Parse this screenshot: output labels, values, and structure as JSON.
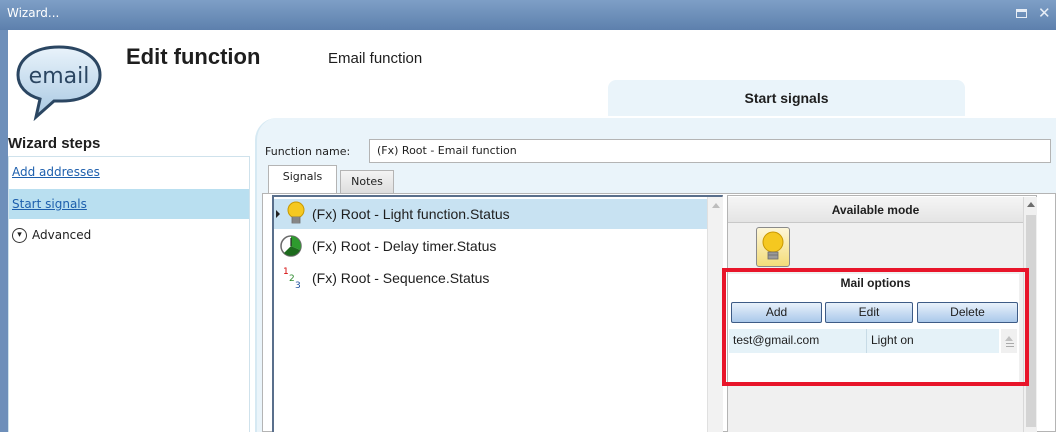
{
  "window": {
    "title": "Wizard...",
    "restore_icon": "restore-icon",
    "close_icon": "close-icon"
  },
  "header": {
    "logo_text": "email",
    "title": "Edit function",
    "subtitle": "Email function",
    "active_tab": "Start signals"
  },
  "sidebar": {
    "header": "Wizard steps",
    "items": [
      {
        "label": "Add addresses"
      },
      {
        "label": "Start signals"
      },
      {
        "label": "Advanced"
      }
    ]
  },
  "form": {
    "function_name_label": "Function name:",
    "function_name_value": "(Fx) Root - Email function"
  },
  "tabs": [
    {
      "label": "Signals"
    },
    {
      "label": "Notes"
    }
  ],
  "signals": [
    {
      "label": "(Fx) Root - Light function.Status",
      "icon": "lightbulb-icon",
      "selected": true
    },
    {
      "label": "(Fx) Root - Delay timer.Status",
      "icon": "timer-icon",
      "selected": false
    },
    {
      "label": "(Fx) Root - Sequence.Status",
      "icon": "sequence-icon",
      "selected": false
    }
  ],
  "available_mode": {
    "header": "Available mode",
    "icon": "lightbulb-icon"
  },
  "mail_options": {
    "title": "Mail options",
    "buttons": {
      "add": "Add",
      "edit": "Edit",
      "delete": "Delete"
    },
    "rows": [
      {
        "email": "test@gmail.com",
        "event": "Light on"
      }
    ]
  },
  "colors": {
    "highlight_border": "#e8152a",
    "titlebar": "#6e8fba",
    "selection": "#c8e2f2",
    "link": "#1d5fad"
  }
}
